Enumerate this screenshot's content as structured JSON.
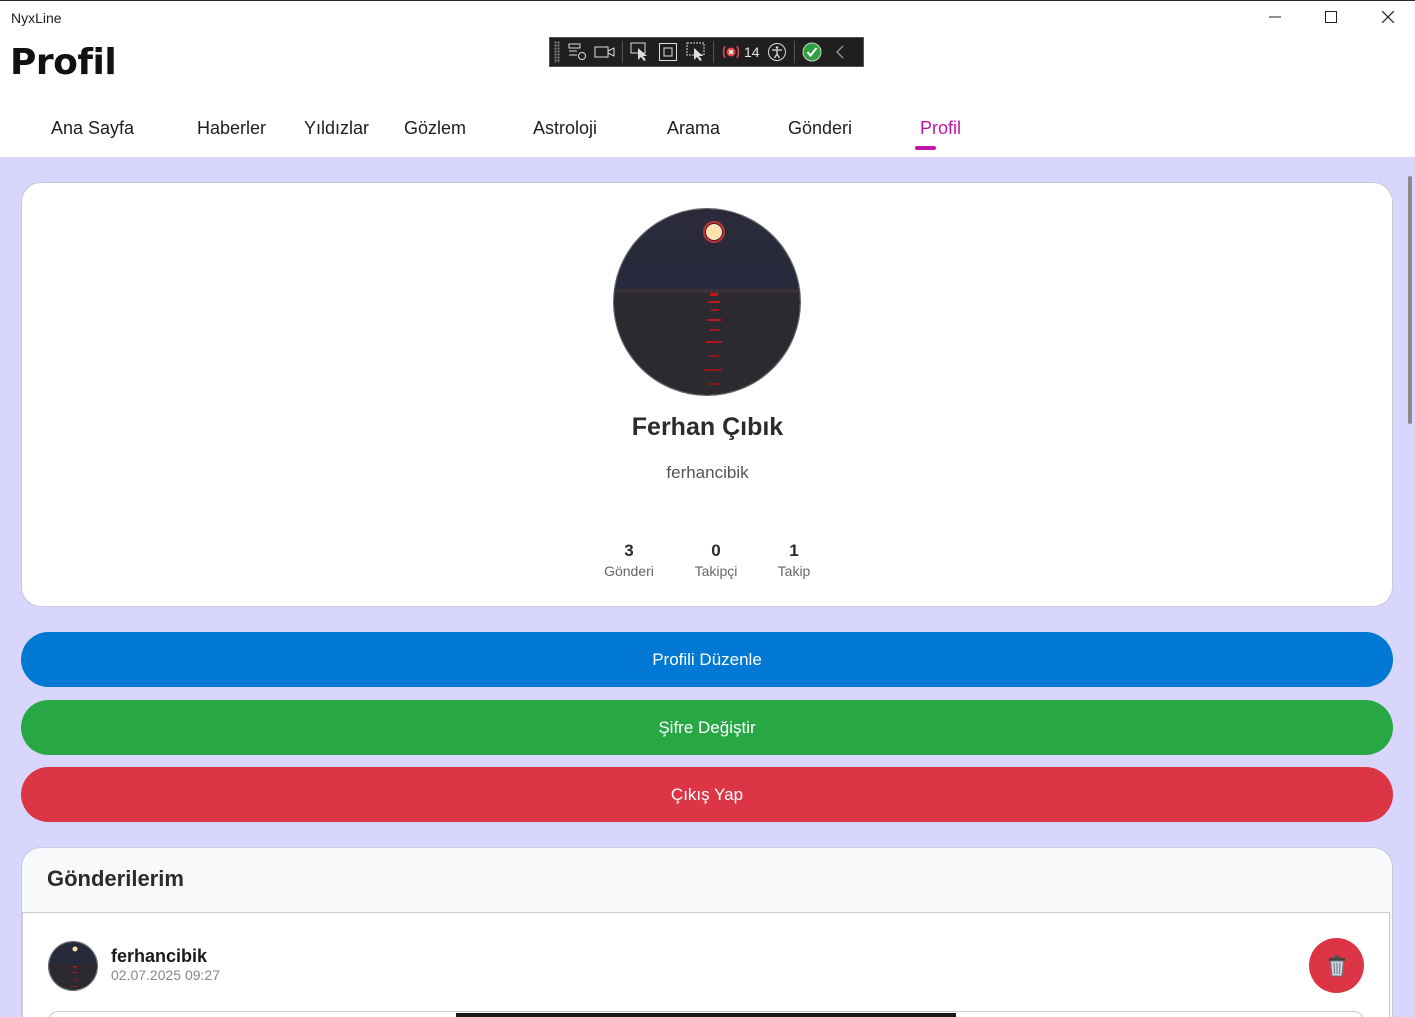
{
  "window": {
    "title": "NyxLine",
    "minimize_icon": "minimize-icon",
    "maximize_icon": "maximize-icon",
    "close_icon": "close-icon"
  },
  "debug_toolbar": {
    "issue_count": "14"
  },
  "header": {
    "title": "Profil"
  },
  "tabs": [
    {
      "label": "Ana Sayfa",
      "active": false
    },
    {
      "label": "Haberler",
      "active": false
    },
    {
      "label": "Yıldızlar",
      "active": false
    },
    {
      "label": "Gözlem",
      "active": false
    },
    {
      "label": "Astroloji",
      "active": false
    },
    {
      "label": "Arama",
      "active": false
    },
    {
      "label": "Gönderi",
      "active": false
    },
    {
      "label": "Profil",
      "active": true
    }
  ],
  "profile": {
    "display_name": "Ferhan Çıbık",
    "username": "ferhancibik",
    "stats": [
      {
        "value": "3",
        "label": "Gönderi"
      },
      {
        "value": "0",
        "label": "Takipçi"
      },
      {
        "value": "1",
        "label": "Takip"
      }
    ]
  },
  "actions": {
    "edit_profile": "Profili Düzenle",
    "change_password": "Şifre Değiştir",
    "logout": "Çıkış Yap"
  },
  "posts": {
    "title": "Gönderilerim",
    "items": [
      {
        "username": "ferhancibik",
        "date": "02.07.2025 09:27"
      }
    ]
  },
  "colors": {
    "accent": "#c016a8",
    "primary": "#0078d4",
    "success": "#28a745",
    "danger": "#dc3545",
    "background": "#d8d6fc"
  }
}
